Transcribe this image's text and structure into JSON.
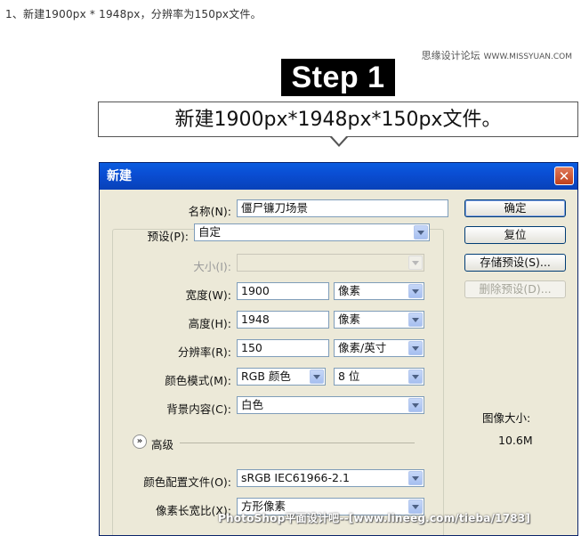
{
  "intro_text": "1、新建1900px * 1948px，分辨率为150px文件。",
  "site_watermark": {
    "name": "思缘设计论坛",
    "url": "WWW.MISSYUAN.COM"
  },
  "step_label": "Step 1",
  "callout_text": "新建1900px*1948px*150px文件。",
  "dialog": {
    "title": "新建",
    "close_glyph": "✕",
    "name": {
      "label": "名称(N):",
      "value": "僵尸镰刀场景"
    },
    "preset": {
      "label": "预设(P):",
      "value": "自定"
    },
    "size": {
      "label": "大小(I):",
      "value": ""
    },
    "width": {
      "label": "宽度(W):",
      "value": "1900",
      "unit": "像素"
    },
    "height": {
      "label": "高度(H):",
      "value": "1948",
      "unit": "像素"
    },
    "resolution": {
      "label": "分辨率(R):",
      "value": "150",
      "unit": "像素/英寸"
    },
    "color_mode": {
      "label": "颜色模式(M):",
      "value": "RGB 颜色",
      "depth": "8 位"
    },
    "background": {
      "label": "背景内容(C):",
      "value": "白色"
    },
    "advanced": {
      "toggle_glyph": "»",
      "label": "高级"
    },
    "color_profile": {
      "label": "颜色配置文件(O):",
      "value": "sRGB IEC61966-2.1"
    },
    "pixel_aspect": {
      "label": "像素长宽比(X):",
      "value": "方形像素"
    },
    "buttons": {
      "ok": "确定",
      "reset": "复位",
      "save_preset": "存储预设(S)...",
      "delete_preset": "删除预设(D)..."
    },
    "image_size_label": "图像大小:",
    "image_size_value": "10.6M"
  },
  "bottom_watermark": "PhotoShop平面设计吧--[www.lineeg.com/tieba/1783]"
}
